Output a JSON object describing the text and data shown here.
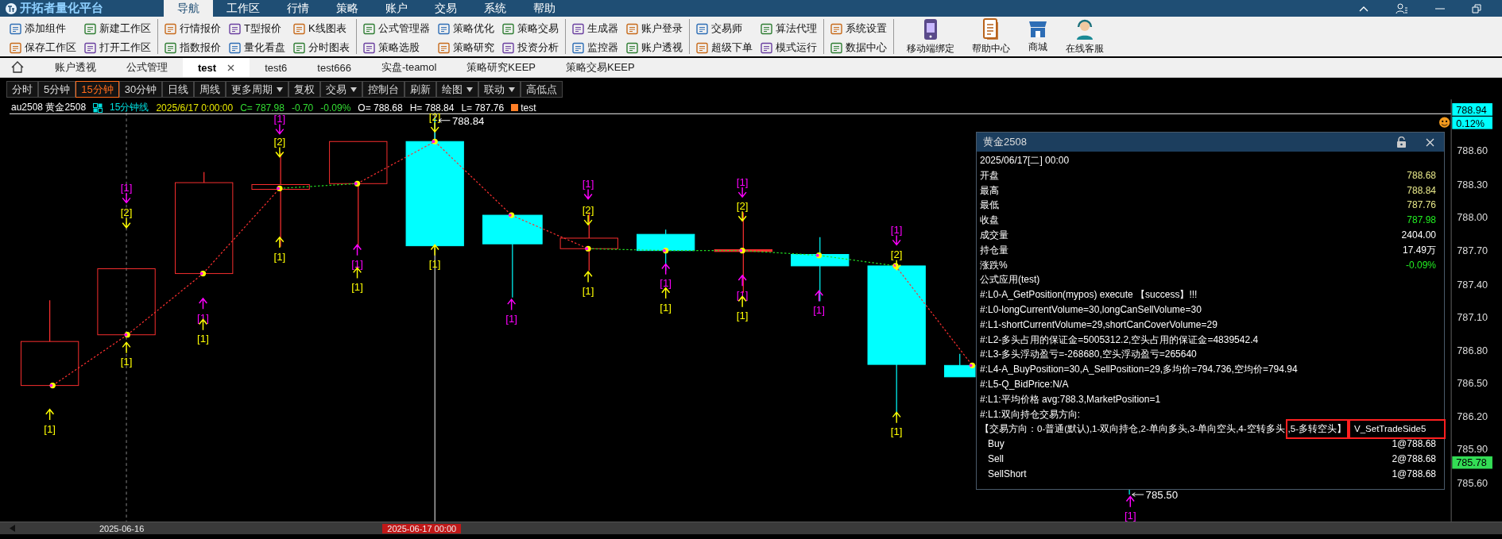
{
  "menu_bar": {
    "title": "开拓者量化平台",
    "items": [
      {
        "label": "导航",
        "selected": true
      },
      {
        "label": "工作区",
        "selected": false
      },
      {
        "label": "行情",
        "selected": false
      },
      {
        "label": "策略",
        "selected": false
      },
      {
        "label": "账户",
        "selected": false
      },
      {
        "label": "交易",
        "selected": false
      },
      {
        "label": "系统",
        "selected": false
      },
      {
        "label": "帮助",
        "selected": false
      }
    ]
  },
  "ribbon": {
    "groups": [
      [
        "添加组件",
        "保存工作区",
        "新建工作区",
        "打开工作区"
      ],
      [
        "行情报价",
        "指数报价",
        "T型报价",
        "量化看盘",
        "K线图表",
        "分时图表"
      ],
      [
        "公式管理器",
        "策略选股",
        "策略优化",
        "策略研究",
        "策略交易",
        "投资分析"
      ],
      [
        "生成器",
        "监控器",
        "账户登录",
        "账户透视"
      ],
      [
        "交易师",
        "超级下单",
        "算法代理",
        "模式运行"
      ],
      [
        "系统设置",
        "数据中心"
      ]
    ],
    "large_buttons": [
      "移动端绑定",
      "帮助中心",
      "商城",
      "在线客服"
    ]
  },
  "tabs": [
    {
      "label": "账户透视",
      "selected": false
    },
    {
      "label": "公式管理",
      "selected": false
    },
    {
      "label": "test",
      "selected": true
    },
    {
      "label": "test6",
      "selected": false
    },
    {
      "label": "test666",
      "selected": false
    },
    {
      "label": "实盘-teamol",
      "selected": false
    },
    {
      "label": "策略研究KEEP",
      "selected": false
    },
    {
      "label": "策略交易KEEP",
      "selected": false
    }
  ],
  "period_bar": [
    {
      "label": "分时",
      "selected": false,
      "dropdown": false
    },
    {
      "label": "5分钟",
      "selected": false,
      "dropdown": false
    },
    {
      "label": "15分钟",
      "selected": true,
      "dropdown": false
    },
    {
      "label": "30分钟",
      "selected": false,
      "dropdown": false
    },
    {
      "label": "日线",
      "selected": false,
      "dropdown": false
    },
    {
      "label": "周线",
      "selected": false,
      "dropdown": false
    },
    {
      "label": "更多周期",
      "selected": false,
      "dropdown": true
    },
    {
      "label": "复权",
      "selected": false,
      "dropdown": false
    },
    {
      "label": "交易",
      "selected": false,
      "dropdown": true
    },
    {
      "label": "控制台",
      "selected": false,
      "dropdown": false
    },
    {
      "label": "刷新",
      "selected": false,
      "dropdown": false
    },
    {
      "label": "绘图",
      "selected": false,
      "dropdown": true
    },
    {
      "label": "联动",
      "selected": false,
      "dropdown": true
    },
    {
      "label": "高低点",
      "selected": false,
      "dropdown": false
    }
  ],
  "quote_line": [
    {
      "kind": "text",
      "text": "au2508 黄金2508",
      "color": "#ffffff"
    },
    {
      "kind": "icon"
    },
    {
      "kind": "text",
      "text": "15分钟线",
      "color": "#00e0e0"
    },
    {
      "kind": "text",
      "text": "2025/6/17 0:00:00",
      "color": "#e8e800"
    },
    {
      "kind": "text",
      "text": "C= 787.98",
      "color": "#33dd33"
    },
    {
      "kind": "text",
      "text": "-0.70",
      "color": "#33dd33"
    },
    {
      "kind": "text",
      "text": "-0.09%",
      "color": "#33dd33"
    },
    {
      "kind": "text",
      "text": "O= 788.68",
      "color": "#ffffff"
    },
    {
      "kind": "text",
      "text": "H= 788.84",
      "color": "#ffffff"
    },
    {
      "kind": "text",
      "text": "L= 787.76",
      "color": "#ffffff"
    },
    {
      "kind": "swatch",
      "color": "#ff7f27"
    },
    {
      "kind": "text",
      "text": "test",
      "color": "#ffffff"
    }
  ],
  "chart": {
    "price_ticks": [
      "788.60",
      "788.30",
      "788.00",
      "787.70",
      "787.40",
      "787.10",
      "786.80",
      "786.50",
      "786.20",
      "785.90",
      "785.60"
    ],
    "last_price": "788.94",
    "change_percent": "0.12%",
    "current_price": "785.78",
    "high_label": "788.84",
    "low_label": "785.50",
    "signals": [
      {
        "text": "[1]",
        "kind": "buy"
      },
      {
        "text": "[1]",
        "kind": "sellshort"
      },
      {
        "text": "[2]",
        "kind": "sell"
      },
      {
        "text": "[1]",
        "kind": "buy"
      },
      {
        "text": "[1]",
        "kind": "buytocover"
      },
      {
        "text": "[1]",
        "kind": "buy"
      },
      {
        "text": "[1]",
        "kind": "sellshort"
      },
      {
        "text": "[2]",
        "kind": "sell"
      },
      {
        "text": "[1]",
        "kind": "buy"
      },
      {
        "text": "[1]",
        "kind": "buytocover"
      },
      {
        "text": "[1]",
        "kind": "buy"
      },
      {
        "text": "[2]",
        "kind": "sell"
      },
      {
        "text": "[1]",
        "kind": "buy"
      },
      {
        "text": "[1]",
        "kind": "buytocover"
      },
      {
        "text": "[1]",
        "kind": "sellshort"
      },
      {
        "text": "[2]",
        "kind": "sell"
      },
      {
        "text": "[1]",
        "kind": "buy"
      },
      {
        "text": "[1]",
        "kind": "buytocover"
      },
      {
        "text": "[1]",
        "kind": "buy"
      },
      {
        "text": "[1]",
        "kind": "sellshort"
      },
      {
        "text": "[2]",
        "kind": "sell"
      },
      {
        "text": "[1]",
        "kind": "buytocover"
      },
      {
        "text": "[1]",
        "kind": "buy"
      },
      {
        "text": "[1]",
        "kind": "buytocover"
      },
      {
        "text": "[1]",
        "kind": "sellshort"
      },
      {
        "text": "[2]",
        "kind": "sell"
      },
      {
        "text": "[1]",
        "kind": "buy"
      },
      {
        "text": "[1]",
        "kind": "buytocover"
      }
    ],
    "time_labels": [
      {
        "text": "2025-06-16",
        "selected": false
      },
      {
        "text": "2025-06-17 00:00",
        "selected": true
      }
    ]
  },
  "info_panel": {
    "title": "黄金2508",
    "date": "2025/06/17[二] 00:00",
    "quotes": [
      {
        "label": "开盘",
        "value": "788.68",
        "color": "#e8e88a"
      },
      {
        "label": "最高",
        "value": "788.84",
        "color": "#e8e88a"
      },
      {
        "label": "最低",
        "value": "787.76",
        "color": "#e8e88a"
      },
      {
        "label": "收盘",
        "value": "787.98",
        "color": "#22ee22"
      },
      {
        "label": "成交量",
        "value": "2404.00",
        "color": "#ffffff"
      },
      {
        "label": "持仓量",
        "value": "17.49万",
        "color": "#ffffff"
      },
      {
        "label": "涨跌%",
        "value": "-0.09%",
        "color": "#22ee22"
      }
    ],
    "log_lines": [
      "公式应用(test)",
      "#:L0-A_GetPosition(mypos) execute 【success】!!!",
      "#:L0-longCurrentVolume=30,longCanSellVolume=30",
      "#:L1-shortCurrentVolume=29,shortCanCoverVolume=29",
      "#:L2-多头占用的保证金=5005312.2,空头占用的保证金=4839542.4",
      "#:L3-多头浮动盈亏=-268680,空头浮动盈亏=265640",
      "#:L4-A_BuyPosition=30,A_SellPosition=29,多均价=794.736,空均价=794.94",
      "#:L5-Q_BidPrice:N/A",
      "#:L1:平均价格 avg:788.3,MarketPosition=1",
      "#:L1:双向持仓交易方向:"
    ],
    "direction_line": [
      {
        "text": "【交易方向：0-普通(默认),1-双向持仓,2-单向多头,3-单向空头,4-空转多头",
        "highlighted": false
      },
      {
        "text": ",5-多转空头】",
        "highlighted": true
      },
      {
        "text": "V_SetTradeSide5",
        "highlighted": true
      }
    ],
    "trades": [
      {
        "side": "Buy",
        "fill": "1@788.68"
      },
      {
        "side": "Sell",
        "fill": "2@788.68"
      },
      {
        "side": "SellShort",
        "fill": "1@788.68"
      }
    ]
  }
}
